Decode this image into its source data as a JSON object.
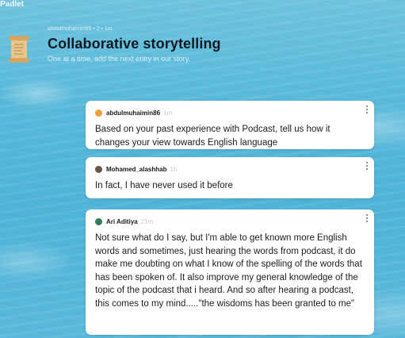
{
  "app": {
    "brand": "Padlet"
  },
  "board": {
    "meta": "abdulmuhaimin86 • 2 • 1m",
    "title": "Collaborative storytelling",
    "subtitle": "One at a time, add the next entry in our story."
  },
  "posts": [
    {
      "author": "abdulmuhaimin86",
      "time": "1m",
      "avatar_color": "#f2a23a",
      "body": "Based on your past experience with Podcast, tell us how it changes your view towards English language"
    },
    {
      "author": "Mohamed_alashhab",
      "time": "1h",
      "avatar_color": "#6b5346",
      "body": "In fact, I have never used it before"
    },
    {
      "author": "Ari Aditiya",
      "time": "21m",
      "avatar_color": "#2e7d5b",
      "body": "Not sure what do I say, but I'm able to get known more English words and sometimes, just hearing the words from podcast, it do make me doubting on what I know of the spelling of the words that has been spoken of. It also improve my general knowledge of the topic of the podcast that i heard. And so after hearing a podcast, this comes to my mind.....\"the wisdoms has been granted to me\""
    }
  ],
  "icons": {
    "board_icon": "scroll-icon",
    "post_menu": "more-vertical-icon"
  }
}
